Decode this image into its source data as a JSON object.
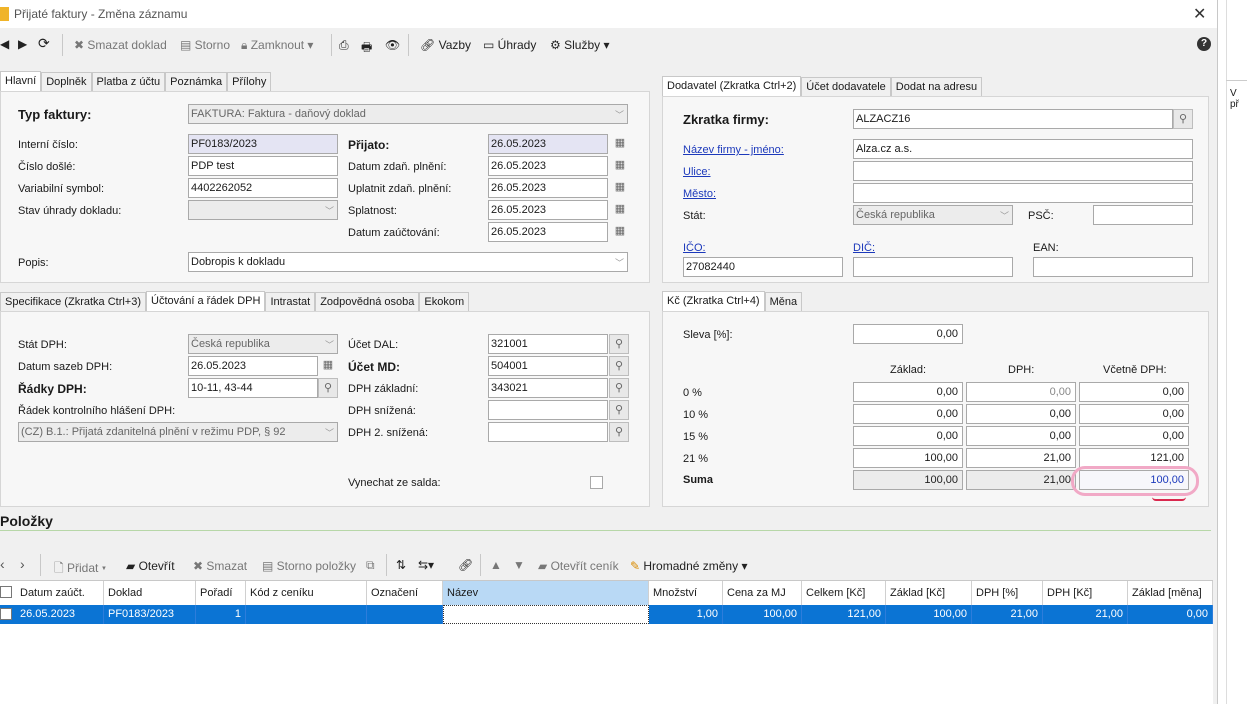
{
  "window": {
    "title": "Přijaté faktury - Změna záznamu"
  },
  "toolbar": {
    "delete_label": "Smazat doklad",
    "storno_label": "Storno",
    "lock_label": "Zamknout",
    "links_label": "Vazby",
    "payments_label": "Úhrady",
    "services_label": "Služby"
  },
  "top_tabs": [
    "Hlavní",
    "Doplněk",
    "Platba z účtu",
    "Poznámka",
    "Přílohy"
  ],
  "header": {
    "type_label": "Typ faktury:",
    "type_value": "FAKTURA: Faktura - daňový doklad",
    "internal_no_label": "Interní číslo:",
    "internal_no": "PF0183/2023",
    "received_no_label": "Číslo došlé:",
    "received_no": "PDP test",
    "var_symbol_label": "Variabilní symbol:",
    "var_symbol": "4402262052",
    "payment_state_label": "Stav úhrady dokladu:",
    "received_label": "Přijato:",
    "received_date": "26.05.2023",
    "tax_date_label": "Datum zdaň. plnění:",
    "tax_date": "26.05.2023",
    "apply_tax_label": "Uplatnit zdaň. plnění:",
    "apply_tax_date": "26.05.2023",
    "due_label": "Splatnost:",
    "due_date": "26.05.2023",
    "posting_label": "Datum zaúčtování:",
    "posting_date": "26.05.2023",
    "desc_label": "Popis:",
    "desc_value": "Dobropis k dokladu"
  },
  "supplier_tabs": [
    "Dodavatel (Zkratka Ctrl+2)",
    "Účet dodavatele",
    "Dodat na adresu"
  ],
  "supplier": {
    "short_label": "Zkratka firmy:",
    "short_value": "ALZACZ16",
    "name_label": "Název firmy - jméno:",
    "name_value": "Alza.cz a.s.",
    "street_label": "Ulice:",
    "city_label": "Město:",
    "country_label": "Stát:",
    "country_value": "Česká republika",
    "zip_label": "PSČ:",
    "ico_label": "IČO:",
    "ico_value": "27082440",
    "dic_label": "DIČ:",
    "ean_label": "EAN:"
  },
  "mid_tabs": [
    "Specifikace (Zkratka Ctrl+3)",
    "Účtování a řádek DPH",
    "Intrastat",
    "Zodpovědná osoba",
    "Ekokom"
  ],
  "accounting": {
    "vat_state_label": "Stát DPH:",
    "vat_state_value": "Česká republika",
    "vat_rate_date_label": "Datum sazeb DPH:",
    "vat_rate_date": "26.05.2023",
    "vat_rows_label": "Řádky DPH:",
    "vat_rows_value": "10-11, 43-44",
    "control_row_label": "Řádek kontrolního hlášení DPH:",
    "control_row_value": "(CZ) B.1.: Přijatá zdanitelná plnění v režimu PDP, § 92",
    "dal_label": "Účet DAL:",
    "dal_value": "321001",
    "md_label": "Účet MD:",
    "md_value": "504001",
    "vat_base_label": "DPH základní:",
    "vat_base_value": "343021",
    "vat_reduced_label": "DPH snížená:",
    "vat_reduced2_label": "DPH 2. snížená:",
    "skip_label": "Vynechat ze salda:"
  },
  "kc_tabs": [
    "Kč (Zkratka Ctrl+4)",
    "Měna"
  ],
  "kc": {
    "discount_label": "Sleva [%]:",
    "discount_value": "0,00",
    "col_base": "Základ:",
    "col_vat": "DPH:",
    "col_total": "Včetně DPH:",
    "rows": [
      {
        "label": "0 %",
        "base": "0,00",
        "vat": "0,00",
        "total": "0,00"
      },
      {
        "label": "10 %",
        "base": "0,00",
        "vat": "0,00",
        "total": "0,00"
      },
      {
        "label": "15 %",
        "base": "0,00",
        "vat": "0,00",
        "total": "0,00"
      },
      {
        "label": "21 %",
        "base": "100,00",
        "vat": "21,00",
        "total": "121,00"
      }
    ],
    "sum_label": "Suma",
    "sum_base": "100,00",
    "sum_vat": "21,00",
    "sum_total": "100,00"
  },
  "items": {
    "section_title": "Položky",
    "add_label": "Přidat",
    "open_label": "Otevřít",
    "delete_label": "Smazat",
    "storno_label": "Storno položky",
    "open_pricelist_label": "Otevřít ceník",
    "bulk_label": "Hromadné změny",
    "columns": [
      "Datum zaúčt.",
      "Doklad",
      "Pořadí",
      "Kód z ceníku",
      "Označení",
      "Název",
      "Množství",
      "Cena za MJ",
      "Celkem [Kč]",
      "Základ [Kč]",
      "DPH [%]",
      "DPH [Kč]",
      "Základ [měna]"
    ],
    "row": {
      "date": "26.05.2023",
      "doc": "PF0183/2023",
      "order": "1",
      "code": "",
      "mark": "",
      "name": "",
      "qty": "1,00",
      "unit_price": "100,00",
      "total": "121,00",
      "base": "100,00",
      "vat_pct": "21,00",
      "vat_kc": "21,00",
      "base_cur": "0,00"
    }
  },
  "right_side": {
    "text": "V př"
  }
}
